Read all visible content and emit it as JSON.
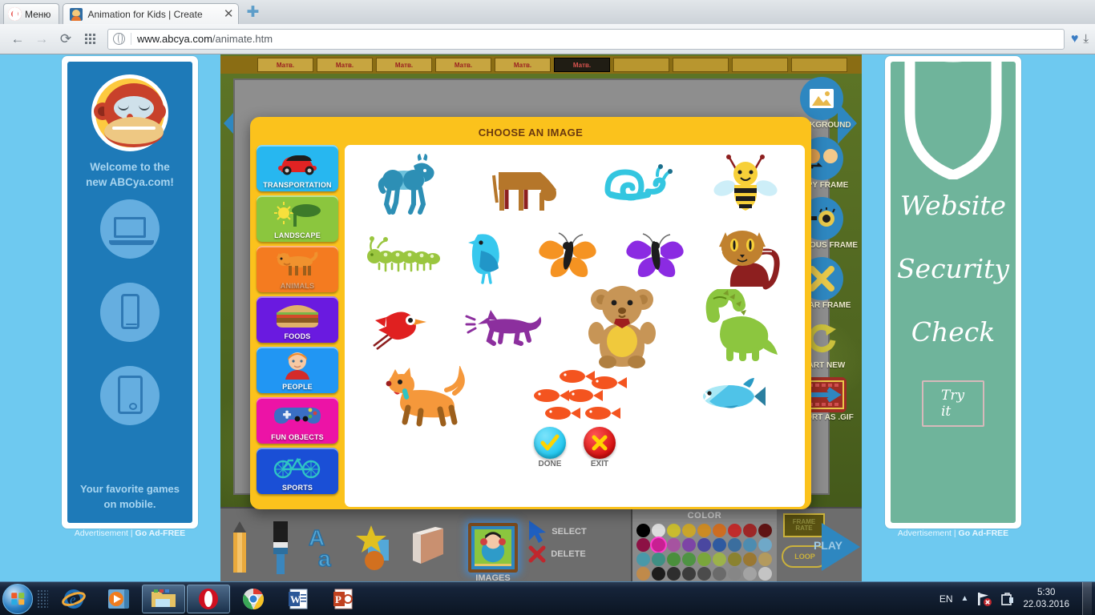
{
  "window": {
    "background_app_title": "",
    "minimize": "–",
    "restore": "❐",
    "close": "✕"
  },
  "browser": {
    "menu_label": "Меню",
    "tab_title": "Animation for Kids | Create",
    "tab_close": "✕",
    "new_tab": "✚",
    "back": "←",
    "forward": "→",
    "reload": "⟳",
    "url_domain": "www.abcya.com",
    "url_path": "/animate.htm",
    "bookmark_icon": "♥",
    "download_icon": "⤓"
  },
  "ads": {
    "left": {
      "headline": "Welcome to the\nnew ABCya.com!",
      "footline": "Your favorite games\non mobile.",
      "footer_label": "Advertisement",
      "footer_sep": "|",
      "footer_link": "Go Ad-FREE"
    },
    "right": {
      "line1": "Website",
      "line2": "Security",
      "line3": "Check",
      "cta": "Try it",
      "footer_label": "Advertisement",
      "footer_sep": "|",
      "footer_link": "Go Ad-FREE"
    }
  },
  "app": {
    "frames": [
      "Матв.",
      "Матв.",
      "Матв.",
      "Матв.",
      "Матв.",
      "Матв.",
      "",
      "",
      "",
      ""
    ],
    "active_frame_index": 5,
    "prev_arrow": "◀",
    "next_arrow": "▶",
    "tools_right": [
      {
        "label": "BACKGROUND",
        "icon": "picture-icon"
      },
      {
        "label": "COPY FRAME",
        "icon": "copy-frame-icon"
      },
      {
        "label": "PREVIOUS FRAME",
        "icon": "onion-skin-icon"
      },
      {
        "label": "CLEAR FRAME",
        "icon": "clear-x-icon"
      },
      {
        "label": "START NEW",
        "icon": "refresh-icon"
      },
      {
        "label": "EXPORT AS .GIF",
        "icon": "export-gif-icon"
      }
    ],
    "tools_bottom": [
      {
        "label": "",
        "icon": "pencil-icon"
      },
      {
        "label": "",
        "icon": "paintbrush-icon"
      },
      {
        "label": "",
        "icon": "text-icon"
      },
      {
        "label": "",
        "icon": "shapes-icon"
      },
      {
        "label": "",
        "icon": "eraser-icon"
      },
      {
        "label": "IMAGES",
        "icon": "images-icon"
      },
      {
        "label": "SELECT",
        "icon": "cursor-arrow-icon"
      },
      {
        "label": "DELETE",
        "icon": "delete-x-icon"
      }
    ],
    "color_title": "COLOR",
    "palette": [
      [
        "#000000",
        "#dcdcdc",
        "#c9bc2f",
        "#c9a52b",
        "#cc8b24",
        "#cd6d22",
        "#c02b2b",
        "#9d2727",
        "#5f1414"
      ],
      [
        "#8c1144",
        "#c82092",
        "#a653a0",
        "#7d44a6",
        "#4a47a0",
        "#2f5aa0",
        "#3b6e9e",
        "#4d8cb0",
        "#6fa8c8"
      ],
      [
        "#4a98a8",
        "#3f8f84",
        "#4a8f3c",
        "#4f9344",
        "#7aa63c",
        "#9cb24a",
        "#8a8230",
        "#9a7833",
        "#b39a5e"
      ],
      [
        "#c08a4a",
        "#1c1c1c",
        "#2e2e2e",
        "#3c3c3c",
        "#4b4b4b",
        "#6a6a6a",
        "#868686",
        "#a3a3a3",
        "#c4c4c4"
      ]
    ],
    "selected_swatch": {
      "row": 1,
      "col": 1
    },
    "frame_rate_label": "FRAME RATE",
    "loop_label": "LOOP",
    "play_label": "PLAY"
  },
  "modal": {
    "title": "CHOOSE AN IMAGE",
    "categories": [
      {
        "label": "TRANSPORTATION",
        "color": "#27b7f0",
        "icon": "car-icon",
        "active": false
      },
      {
        "label": "LANDSCAPE",
        "color": "#8bc63e",
        "icon": "tree-sun-icon",
        "active": false
      },
      {
        "label": "ANIMALS",
        "color": "#f47b20",
        "icon": "dog-icon",
        "active": true
      },
      {
        "label": "FOODS",
        "color": "#6a1ae0",
        "icon": "burger-icon",
        "active": false
      },
      {
        "label": "PEOPLE",
        "color": "#2196f3",
        "icon": "boy-icon",
        "active": false
      },
      {
        "label": "FUN OBJECTS",
        "color": "#ec13a6",
        "icon": "gamepad-icon",
        "active": false
      },
      {
        "label": "SPORTS",
        "color": "#1a4fd6",
        "icon": "bicycle-icon",
        "active": false
      }
    ],
    "gallery_rows": [
      [
        {
          "name": "horse",
          "color": "#2d8fb5"
        },
        {
          "name": "cow",
          "color": "#b5762a"
        },
        {
          "name": "snail",
          "color": "#34c6e0"
        },
        {
          "name": "bee",
          "color": "#f7d039"
        }
      ],
      [
        {
          "name": "caterpillar",
          "color": "#9ac63f"
        },
        {
          "name": "bird-blue",
          "color": "#37c8ee"
        },
        {
          "name": "butterfly-orange",
          "color": "#f59322"
        },
        {
          "name": "butterfly-purple",
          "color": "#8b2be2"
        },
        {
          "name": "cat",
          "color": "#c0812f"
        }
      ],
      [
        {
          "name": "bird-red",
          "color": "#e02020"
        },
        {
          "name": "dog-barking",
          "color": "#8c2f9e"
        },
        {
          "name": "teddy-bear",
          "color": "#c79556"
        },
        {
          "name": "dinosaur",
          "color": "#8cc63f"
        }
      ],
      [
        {
          "name": "dog-orange",
          "color": "#f5983b"
        },
        {
          "name": "fish-school",
          "color": "#f4541f"
        },
        {
          "name": "fish-blue",
          "color": "#4fc3e8"
        }
      ]
    ],
    "done_label": "DONE",
    "exit_label": "EXIT",
    "done_glyph": "✔",
    "exit_glyph": "✖"
  },
  "taskbar": {
    "apps": [
      {
        "name": "internet-explorer",
        "active": false
      },
      {
        "name": "media-player",
        "active": false
      },
      {
        "name": "file-explorer",
        "active": true
      },
      {
        "name": "opera",
        "active": true
      },
      {
        "name": "chrome",
        "active": false
      },
      {
        "name": "word",
        "active": false
      },
      {
        "name": "powerpoint",
        "active": false
      }
    ],
    "language": "EN",
    "tray_up": "▲",
    "time": "5:30",
    "date": "22.03.2016"
  }
}
